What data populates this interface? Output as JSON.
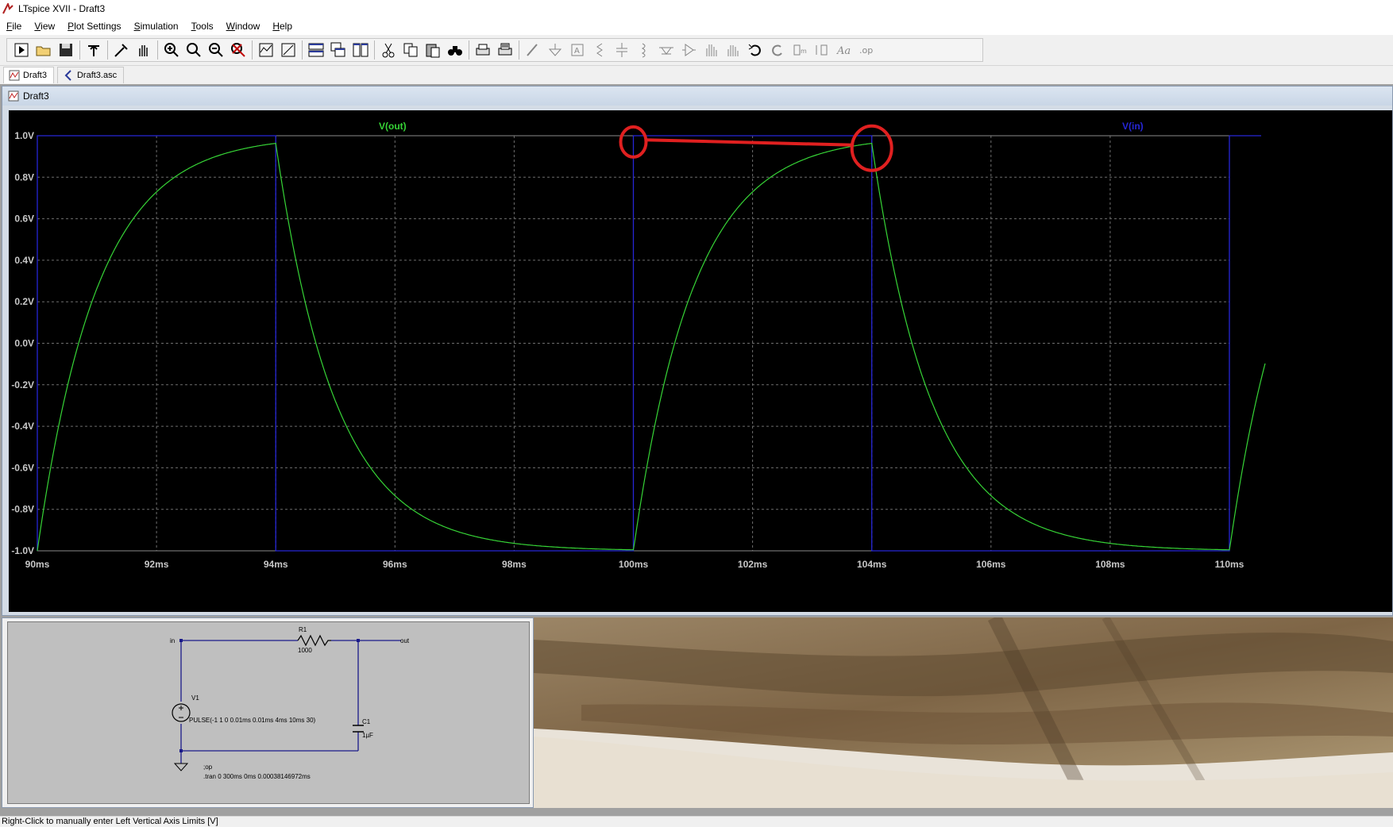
{
  "window": {
    "title": "LTspice XVII - Draft3"
  },
  "menu": [
    {
      "label": "File",
      "mnemonic": "F"
    },
    {
      "label": "View",
      "mnemonic": "V"
    },
    {
      "label": "Plot Settings",
      "mnemonic": "P"
    },
    {
      "label": "Simulation",
      "mnemonic": "S"
    },
    {
      "label": "Tools",
      "mnemonic": "T"
    },
    {
      "label": "Window",
      "mnemonic": "W"
    },
    {
      "label": "Help",
      "mnemonic": "H"
    }
  ],
  "toolbar": {
    "groups": [
      [
        "run-icon",
        "open-icon",
        "save-icon"
      ],
      [
        "control-panel-icon"
      ],
      [
        "pick-probe-icon",
        "pan-hand-icon"
      ],
      [
        "zoom-in-icon",
        "zoom-area-icon",
        "zoom-out-icon",
        "zoom-cancel-icon"
      ],
      [
        "autorange-icon",
        "mark-unused-icon"
      ],
      [
        "tile-horizontal-icon",
        "cascade-icon",
        "tile-vertical-icon"
      ],
      [
        "cut-icon",
        "copy-icon",
        "paste-icon",
        "find-icon"
      ],
      [
        "print-icon",
        "print-setup-icon"
      ],
      [
        "draw-wire-icon",
        "ground-icon",
        "label-net-icon",
        "resistor-icon",
        "capacitor-icon",
        "inductor-icon",
        "diode-icon",
        "component-icon",
        "move-icon",
        "drag-icon",
        "undo-icon",
        "redo-icon",
        "rotate-icon",
        "mirror-icon",
        "text-icon",
        "spice-directive-icon"
      ]
    ]
  },
  "tabs": [
    {
      "label": "Draft3",
      "icon": "waveform-tab-icon",
      "active": true
    },
    {
      "label": "Draft3.asc",
      "icon": "schematic-tab-icon",
      "active": false
    }
  ],
  "plot_window": {
    "title": "Draft3"
  },
  "chart_data": {
    "type": "line",
    "title": "",
    "xlabel": "",
    "ylabel": "",
    "x_ticks": [
      "90ms",
      "92ms",
      "94ms",
      "96ms",
      "98ms",
      "100ms",
      "102ms",
      "104ms",
      "106ms",
      "108ms",
      "110ms"
    ],
    "y_ticks": [
      "1.0V",
      "0.8V",
      "0.6V",
      "0.4V",
      "0.2V",
      "0.0V",
      "-0.2V",
      "-0.4V",
      "-0.6V",
      "-0.8V",
      "-1.0V"
    ],
    "xlim": [
      90,
      110
    ],
    "ylim": [
      -1.0,
      1.0
    ],
    "grid": true,
    "series": [
      {
        "name": "V(out)",
        "color": "#36d436",
        "kind": "rc-response",
        "tau_ms": 1.0,
        "period_ms": 10,
        "high_ms": 4,
        "v_high": 1.0,
        "v_low": -1.0
      },
      {
        "name": "V(in)",
        "color": "#2626d6",
        "kind": "pulse",
        "edges_ms": [
          90,
          94,
          100,
          104,
          110
        ],
        "v_high": 1.0,
        "v_low": -1.0
      }
    ],
    "annotations": [
      {
        "type": "circle",
        "color": "#e02020",
        "x_ms": 100.0,
        "y_v": 0.97
      },
      {
        "type": "circle",
        "color": "#e02020",
        "x_ms": 104.0,
        "y_v": 0.94
      },
      {
        "type": "line",
        "color": "#e02020",
        "x1_ms": 100.2,
        "y1_v": 0.98,
        "x2_ms": 103.7,
        "y2_v": 0.955
      }
    ]
  },
  "schematic": {
    "labels": {
      "in": "in",
      "out": "out",
      "r1_name": "R1",
      "r1_value": "1000",
      "v1_name": "V1",
      "v1_value": "PULSE(-1 1 0 0.01ms 0.01ms 4ms 10ms 30)",
      "c1_name": "C1",
      "c1_value": "1µF",
      "op": ";op",
      "tran": ".tran 0 300ms 0ms 0.00038146972ms"
    }
  },
  "status": {
    "text": "Right-Click to manually enter Left Vertical Axis Limits [V]"
  },
  "colors": {
    "plot_bg": "#000000",
    "grid": "#6e6e6e",
    "vout": "#36d436",
    "vin": "#2626d6",
    "annotation": "#e02020"
  }
}
